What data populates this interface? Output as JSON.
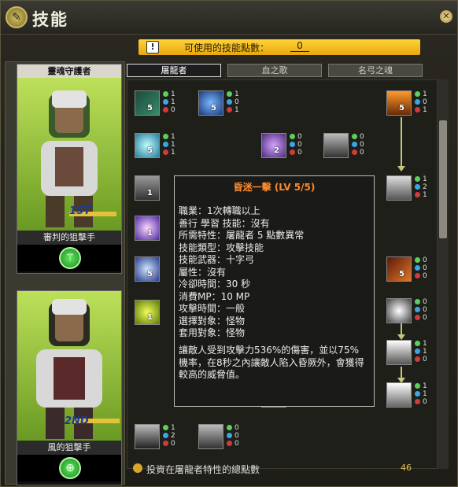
{
  "window": {
    "title": "技能",
    "close_label": "✕"
  },
  "points": {
    "label": "可使用的技能點數：",
    "value": "0"
  },
  "jobs": [
    {
      "header": "靈魂守護者",
      "name": "審判的狙擊手",
      "tier": "1ST"
    },
    {
      "header": "",
      "name": "風的狙擊手",
      "tier": "2ND"
    }
  ],
  "tabs": [
    "屠龍者",
    "血之歌",
    "名弓之魂"
  ],
  "skills": [
    {
      "id": "s1",
      "lv": "5",
      "g": "1",
      "b": "1",
      "r": "0"
    },
    {
      "id": "s2",
      "lv": "5",
      "g": "1",
      "b": "0",
      "r": "1"
    },
    {
      "id": "s3",
      "lv": "5",
      "g": "1",
      "b": "0",
      "r": "1"
    },
    {
      "id": "s4",
      "lv": "5",
      "g": "1",
      "b": "1",
      "r": "1"
    },
    {
      "id": "s5",
      "lv": "2",
      "g": "0",
      "b": "0",
      "r": "0"
    },
    {
      "id": "s6",
      "lv": "",
      "g": "0",
      "b": "0",
      "r": "0"
    },
    {
      "id": "s7",
      "lv": "",
      "g": "1",
      "b": "2",
      "r": "1"
    },
    {
      "id": "s8",
      "lv": "1",
      "g": "",
      "b": "",
      "r": ""
    },
    {
      "id": "s9",
      "lv": "5",
      "g": "0",
      "b": "0",
      "r": "0"
    },
    {
      "id": "s10",
      "lv": "5",
      "g": "",
      "b": "",
      "r": ""
    },
    {
      "id": "s11",
      "lv": "1",
      "g": "",
      "b": "",
      "r": ""
    },
    {
      "id": "s12",
      "lv": "",
      "g": "2",
      "b": "2",
      "r": "2"
    },
    {
      "id": "s13",
      "lv": "",
      "g": "0",
      "b": "0",
      "r": "0"
    },
    {
      "id": "s14",
      "lv": "",
      "g": "1",
      "b": "1",
      "r": "0"
    },
    {
      "id": "s15",
      "lv": "",
      "g": "1",
      "b": "1",
      "r": "0"
    },
    {
      "id": "s16",
      "lv": "",
      "g": "1",
      "b": "2",
      "r": "0"
    },
    {
      "id": "s17",
      "lv": "",
      "g": "0",
      "b": "0",
      "r": "0"
    },
    {
      "id": "s18",
      "lv": "",
      "g": "1",
      "b": "1",
      "r": "0"
    }
  ],
  "tooltip": {
    "title": "昏迷一擊 (LV 5/5)",
    "lines": [
      "職業：1次轉職以上",
      "善行 學習 技能：沒有",
      "所需特性：屠龍者 5 點數異常",
      "技能類型：攻擊技能",
      "技能武器：十字弓",
      "屬性：沒有",
      "冷卻時間：30 秒",
      "消費MP：10 MP",
      "攻擊時間：一般",
      "選擇對象：怪物",
      "套用對象：怪物"
    ],
    "description": "讓敵人受到攻擊力536%的傷害，並以75%機率，在8秒之內讓敵人陷入昏厥外，會獲得較高的威脅值。"
  },
  "footer": {
    "label": "投資在屠龍者特性的總點數",
    "value": "46"
  }
}
